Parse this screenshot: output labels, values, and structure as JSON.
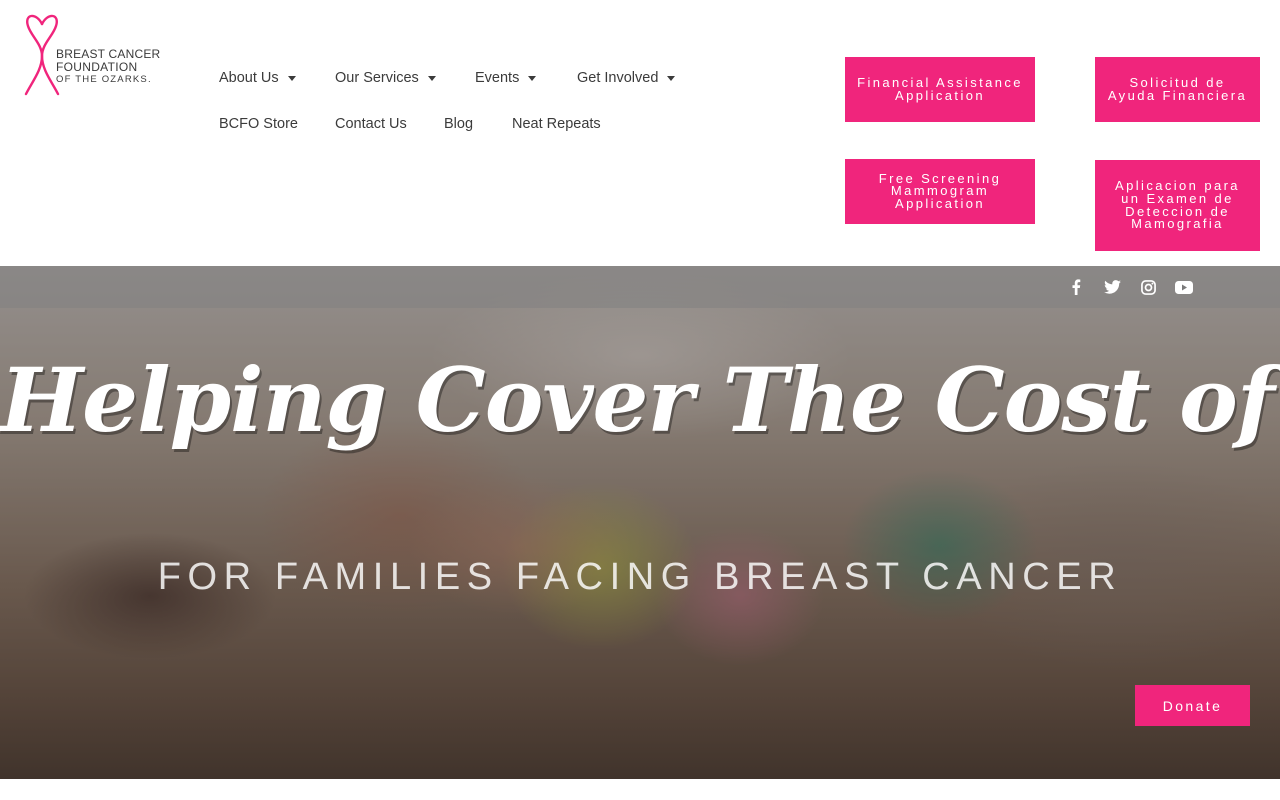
{
  "logo": {
    "line1": "BREAST CANCER",
    "line2": "FOUNDATION",
    "line3": "OF THE OZARKS.",
    "icon": "pink-ribbon-heart-icon",
    "brand_color": "#f0257c"
  },
  "nav": {
    "about": "About Us",
    "services": "Our Services",
    "events": "Events",
    "involved": "Get Involved",
    "store": "BCFO Store",
    "contact": "Contact Us",
    "blog": "Blog",
    "neat": "Neat Repeats"
  },
  "cta": {
    "financial": "Financial Assistance Application",
    "solicitud": "Solicitud de Ayuda Financiera",
    "screening": "Free Screening Mammogram Application",
    "aplicacion": "Aplicacion para un Examen de Deteccion de Mamografia"
  },
  "social": {
    "icons": [
      "facebook-icon",
      "twitter-icon",
      "instagram-icon",
      "youtube-icon"
    ]
  },
  "hero": {
    "title": "Helping Cover The Cost of Life",
    "subtitle": "FOR FAMILIES FACING BREAST CANCER",
    "donate": "Donate"
  },
  "colors": {
    "accent": "#f0257c",
    "nav_text": "#3b3b3b"
  }
}
